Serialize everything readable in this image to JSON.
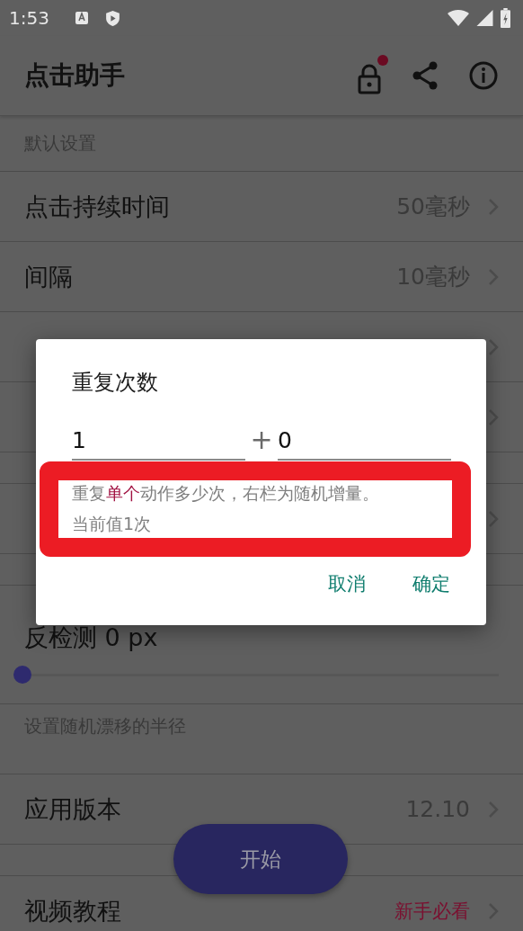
{
  "status_bar": {
    "time": "1:53"
  },
  "app_bar": {
    "title": "点击助手",
    "lock_badge": true
  },
  "rows": [
    {
      "kind": "header",
      "label": "默认设置"
    },
    {
      "kind": "item",
      "label": "点击持续时间",
      "value": "50毫秒"
    },
    {
      "kind": "item",
      "label": "间隔",
      "value": "10毫秒"
    },
    {
      "kind": "item"
    },
    {
      "kind": "item"
    },
    {
      "kind": "gap"
    },
    {
      "kind": "item"
    },
    {
      "kind": "gap"
    },
    {
      "kind": "slider",
      "label": "反检测 0 px",
      "level": 0
    },
    {
      "kind": "note",
      "label": "设置随机漂移的半径"
    },
    {
      "kind": "item",
      "label": "应用版本",
      "value": "12.10"
    },
    {
      "kind": "gap"
    },
    {
      "kind": "item",
      "label": "视频教程",
      "value": "新手必看",
      "accent": true
    }
  ],
  "dialog": {
    "title": "重复次数",
    "fields": [
      {
        "value": "1"
      },
      {
        "value": "0"
      }
    ],
    "separator": "+",
    "hint": [
      "重复**单个**动作多少次，右栏为随机增量。",
      "当前值1次"
    ],
    "buttons": [
      "取消",
      "确定"
    ]
  },
  "fab": {
    "label": "开始"
  }
}
